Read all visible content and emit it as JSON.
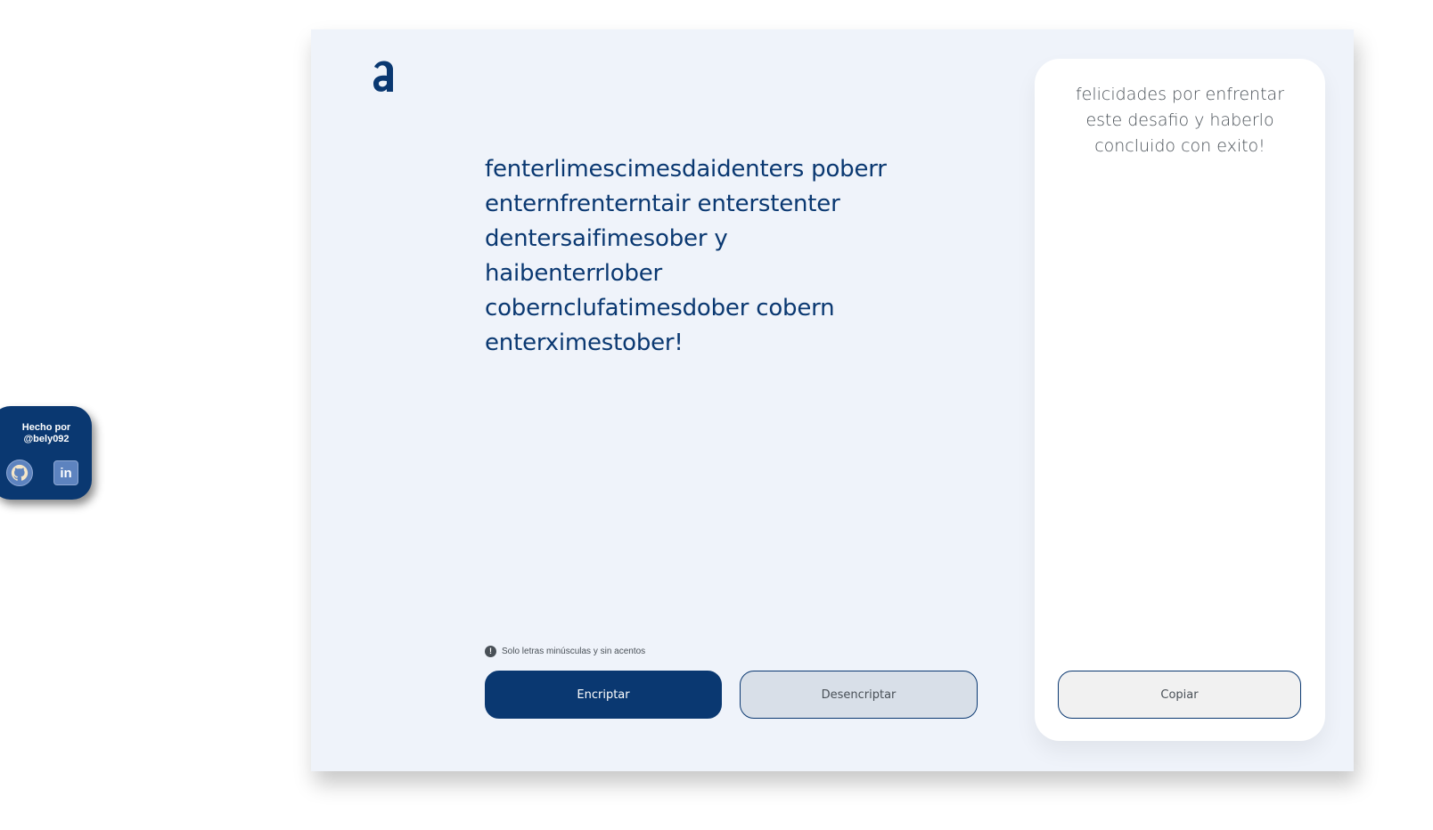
{
  "logo": {
    "icon": "alura-a-logo-icon",
    "color": "#0a3871"
  },
  "input": {
    "value": "fenterlimescimesdaidenters poberr enternfrenterntair enterstenter dentersaifimesober y haibenterrlober cobernclufatimesdober cobern enterximestober!"
  },
  "hint": {
    "icon": "exclamation-icon",
    "text": "Solo letras minúsculas y sin acentos"
  },
  "buttons": {
    "encrypt_label": "Encriptar",
    "decrypt_label": "Desencriptar"
  },
  "output": {
    "text": "felicidades por enfrentar este desafio y haberlo concluido con exito!",
    "copy_label": "Copiar"
  },
  "badge": {
    "text_line1": "Hecho por",
    "text_line2": "@bely092",
    "github_icon": "github-icon",
    "linkedin_icon": "linkedin-icon",
    "linkedin_glyph": "in"
  },
  "colors": {
    "primary": "#0a3871",
    "background": "#eff3fa",
    "text_muted": "#495057"
  }
}
